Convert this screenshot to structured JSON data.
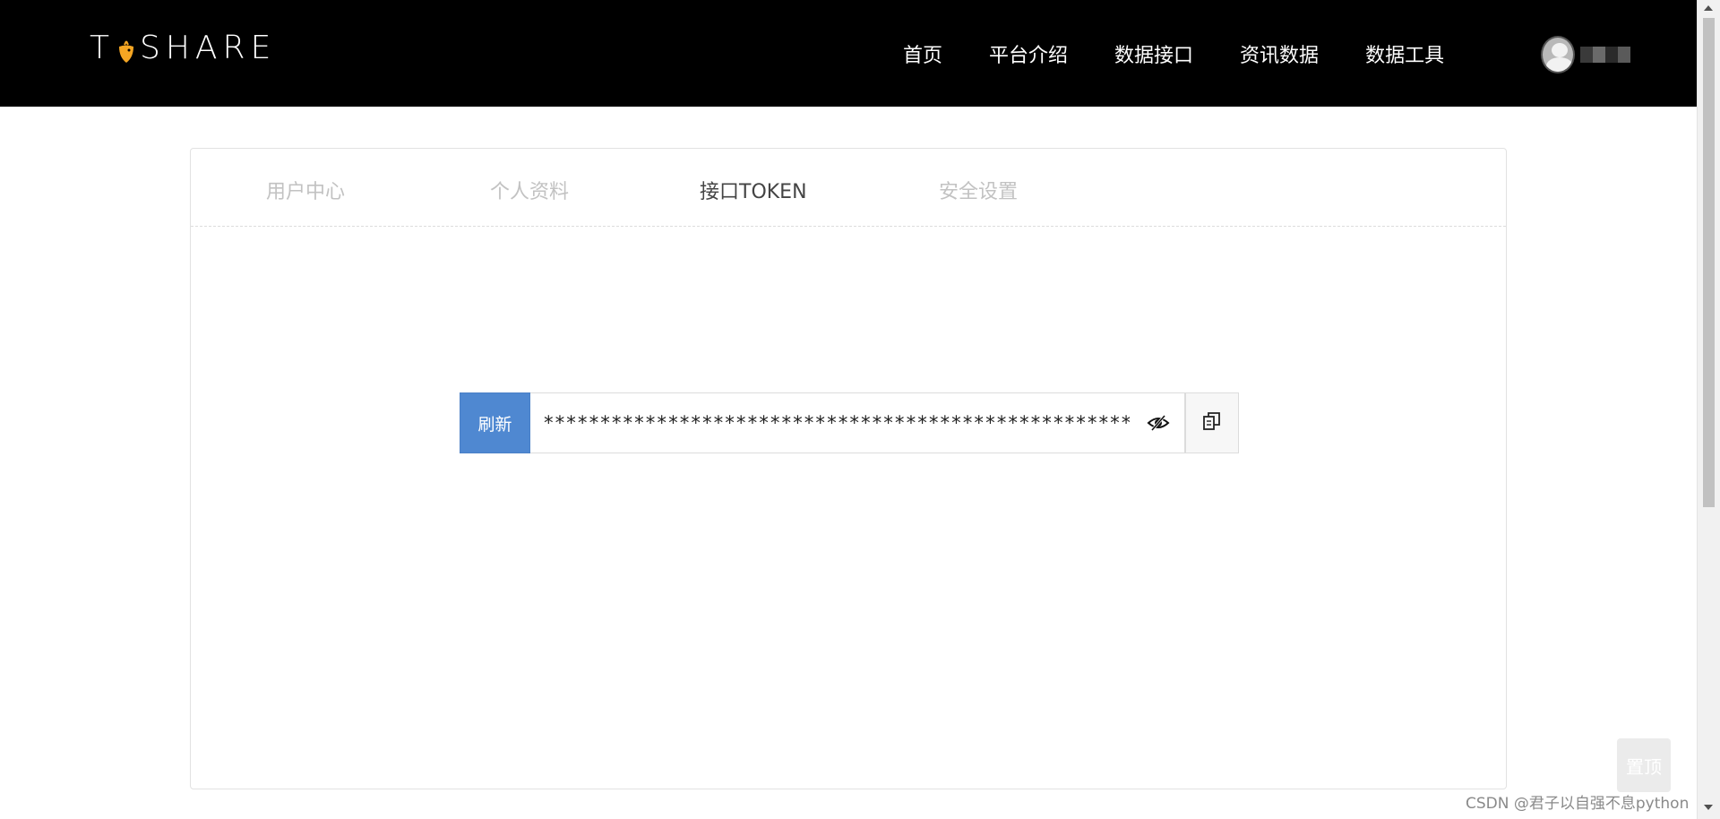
{
  "navbar": {
    "logo_text_left": "T",
    "logo_text_right": "SHARE",
    "links": [
      "首页",
      "平台介绍",
      "数据接口",
      "资讯数据",
      "数据工具"
    ],
    "background": "#000000"
  },
  "tabs": [
    {
      "label": "用户中心",
      "active": false
    },
    {
      "label": "个人资料",
      "active": false
    },
    {
      "label": "接口TOKEN",
      "active": true
    },
    {
      "label": "安全设置",
      "active": false
    }
  ],
  "token": {
    "refresh_label": "刷新",
    "value": "**************************************************************",
    "eye_icon": "eye-slash-icon",
    "copy_icon": "copy-icon",
    "accent_color": "#4f88d1"
  },
  "back_to_top_label": "置顶",
  "watermark": "CSDN @君子以自强不息python"
}
